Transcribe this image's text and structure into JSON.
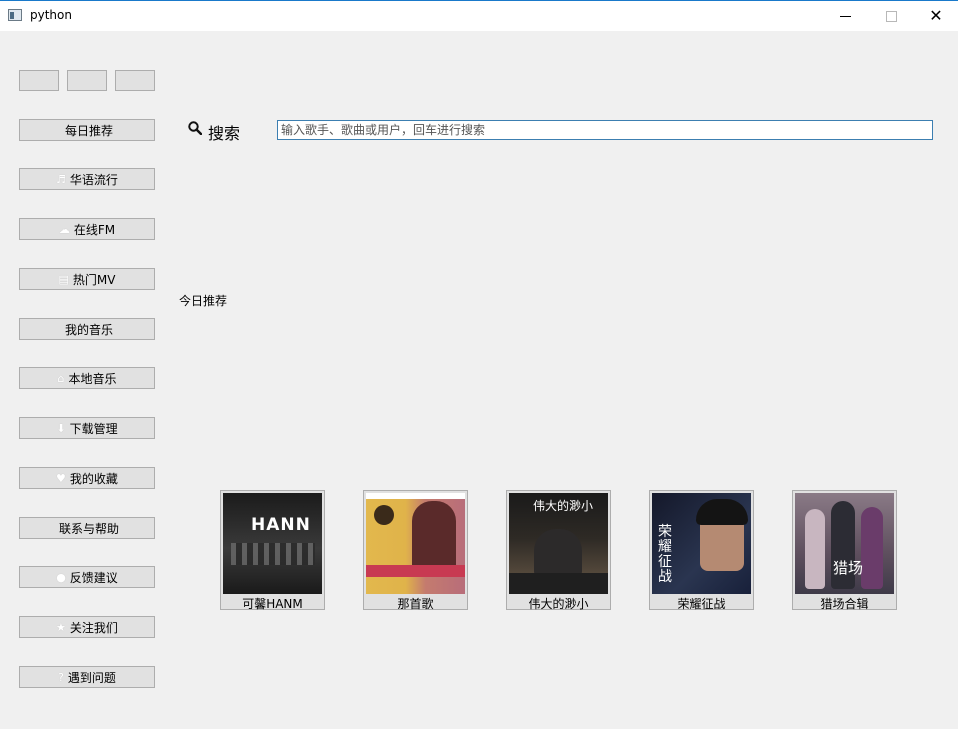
{
  "window": {
    "title": "python",
    "minimize": "—",
    "maximize": "☐",
    "close": "✕"
  },
  "toolbar": {
    "small_buttons": [
      "",
      "",
      ""
    ]
  },
  "sidebar": {
    "items": [
      {
        "label": "每日推荐",
        "icon": ""
      },
      {
        "label": "华语流行",
        "icon": "♬"
      },
      {
        "label": "在线FM",
        "icon": "☁"
      },
      {
        "label": "热门MV",
        "icon": "▤"
      },
      {
        "label": "我的音乐",
        "icon": ""
      },
      {
        "label": "本地音乐",
        "icon": "⌂"
      },
      {
        "label": "下载管理",
        "icon": "⬇"
      },
      {
        "label": "我的收藏",
        "icon": "♥"
      },
      {
        "label": "联系与帮助",
        "icon": ""
      },
      {
        "label": "反馈建议",
        "icon": "●"
      },
      {
        "label": "关注我们",
        "icon": "★"
      },
      {
        "label": "遇到问题",
        "icon": "?"
      }
    ]
  },
  "search": {
    "label": "搜索",
    "placeholder": "输入歌手、歌曲或用户，回车进行搜索",
    "value": ""
  },
  "recommend": {
    "title": "今日推荐",
    "albums": [
      {
        "caption": "可馨HANM",
        "cover_text": "HANN",
        "bg": "#2a2a2a"
      },
      {
        "caption": "那首歌",
        "cover_text": "",
        "bg": "#c9a44a"
      },
      {
        "caption": "伟大的渺小",
        "cover_text": "伟大的渺小",
        "bg": "#3a3530"
      },
      {
        "caption": "荣耀征战",
        "cover_text": "荣耀征战",
        "bg": "#1e2636"
      },
      {
        "caption": "猎场合辑",
        "cover_text": "猎场",
        "bg": "#6e5a6a"
      }
    ]
  }
}
